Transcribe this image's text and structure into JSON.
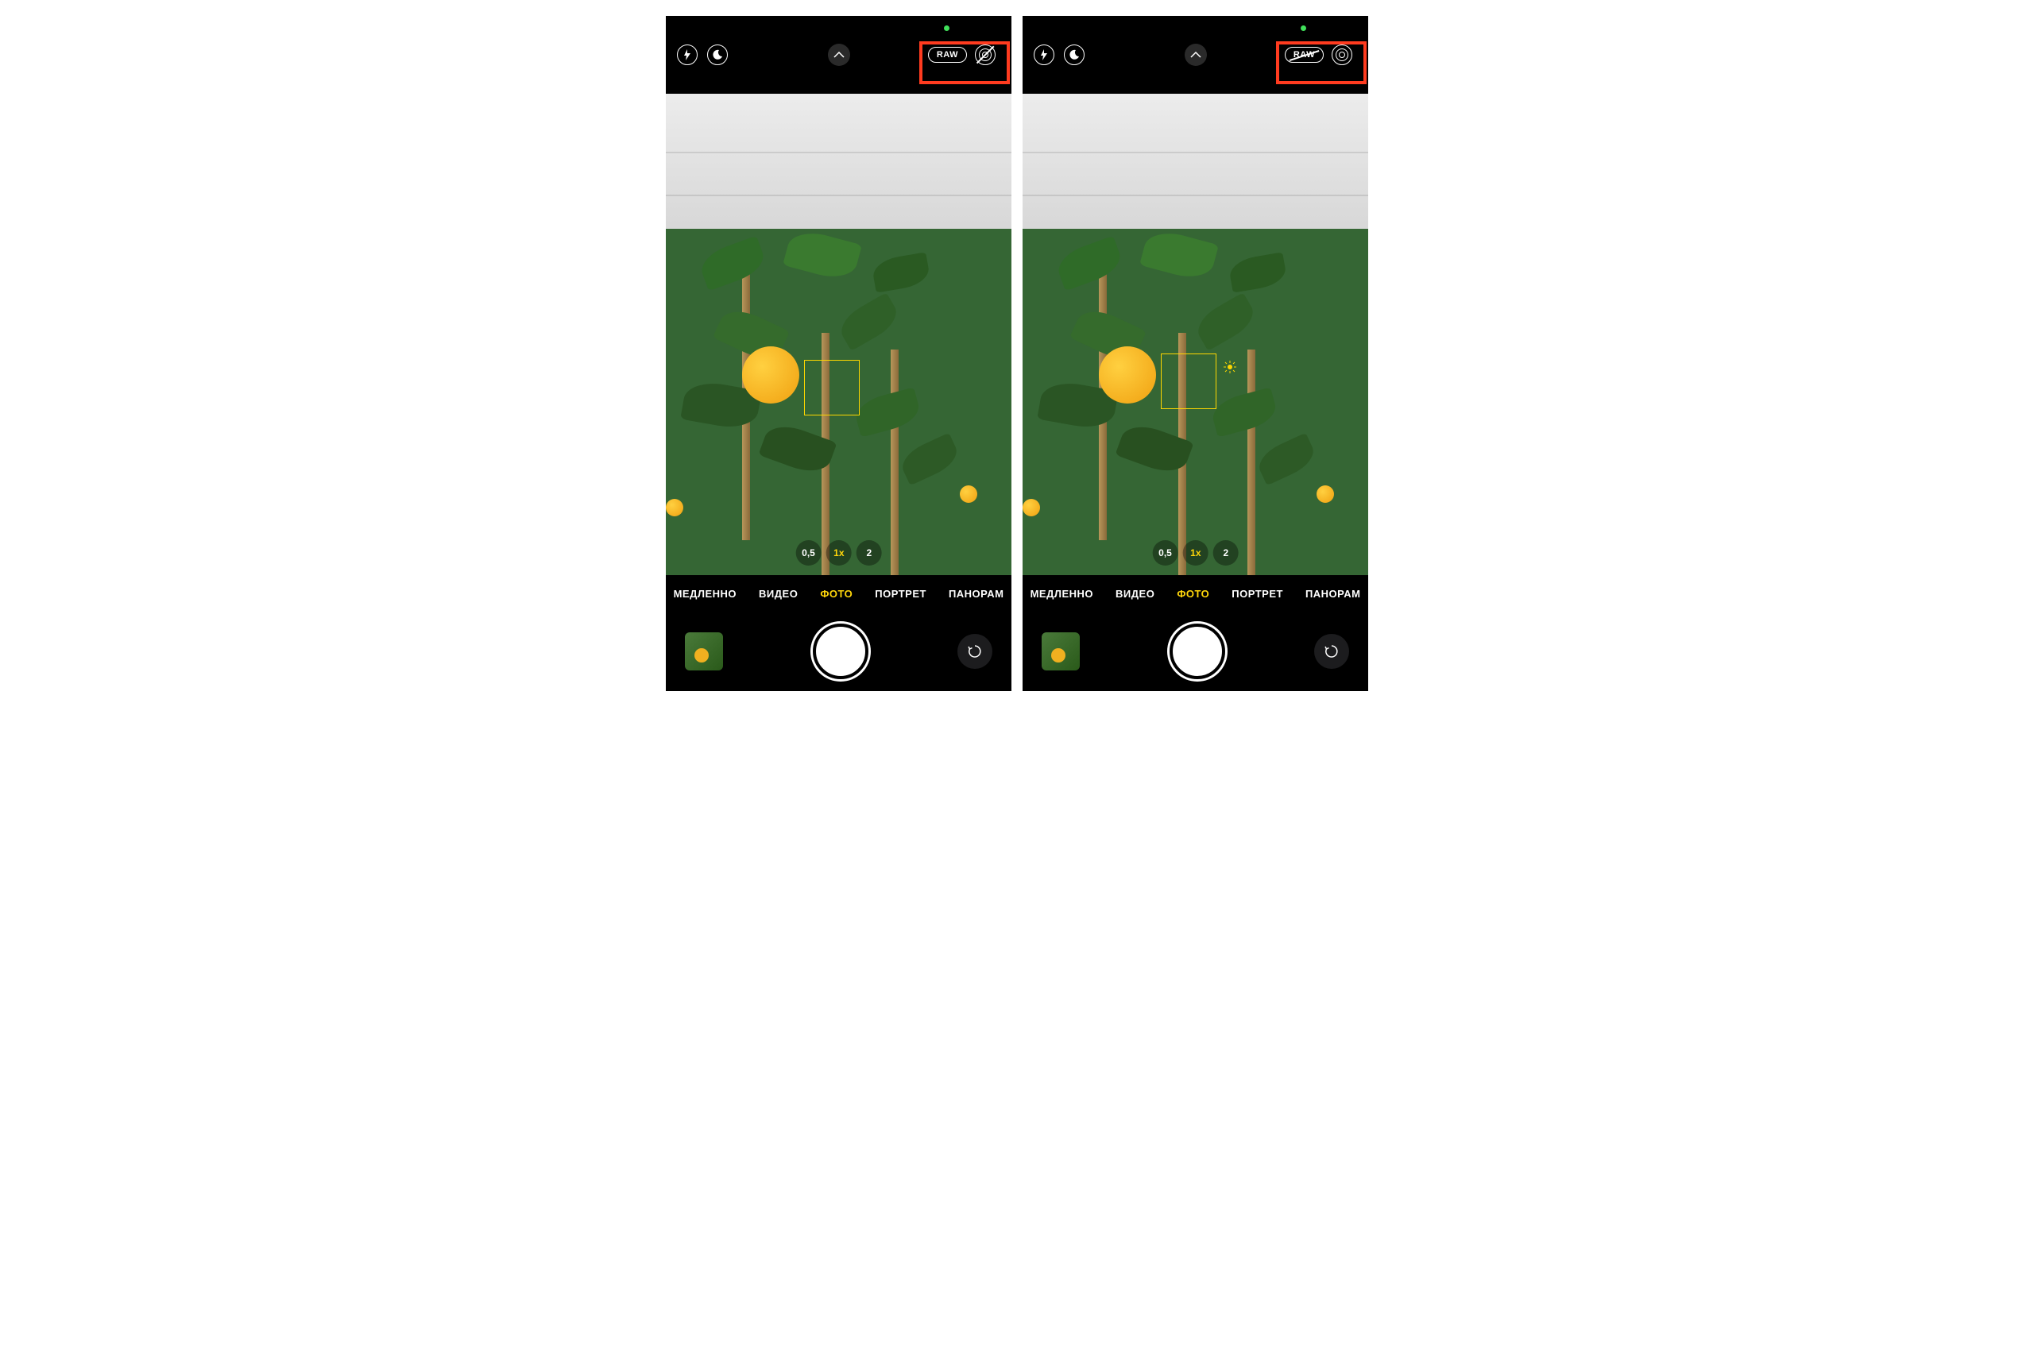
{
  "raw_label": "RAW",
  "zoom": {
    "wide": "0,5",
    "main": "1x",
    "tele": "2"
  },
  "modes": {
    "slow": "МЕДЛЕННО",
    "video": "ВИДЕО",
    "photo": "ФОТО",
    "portrait": "ПОРТРЕТ",
    "pano": "ПАНОРАМ"
  },
  "left_phone": {
    "raw_enabled": true,
    "live_photo_enabled": false
  },
  "right_phone": {
    "raw_enabled": false,
    "live_photo_enabled": true
  }
}
